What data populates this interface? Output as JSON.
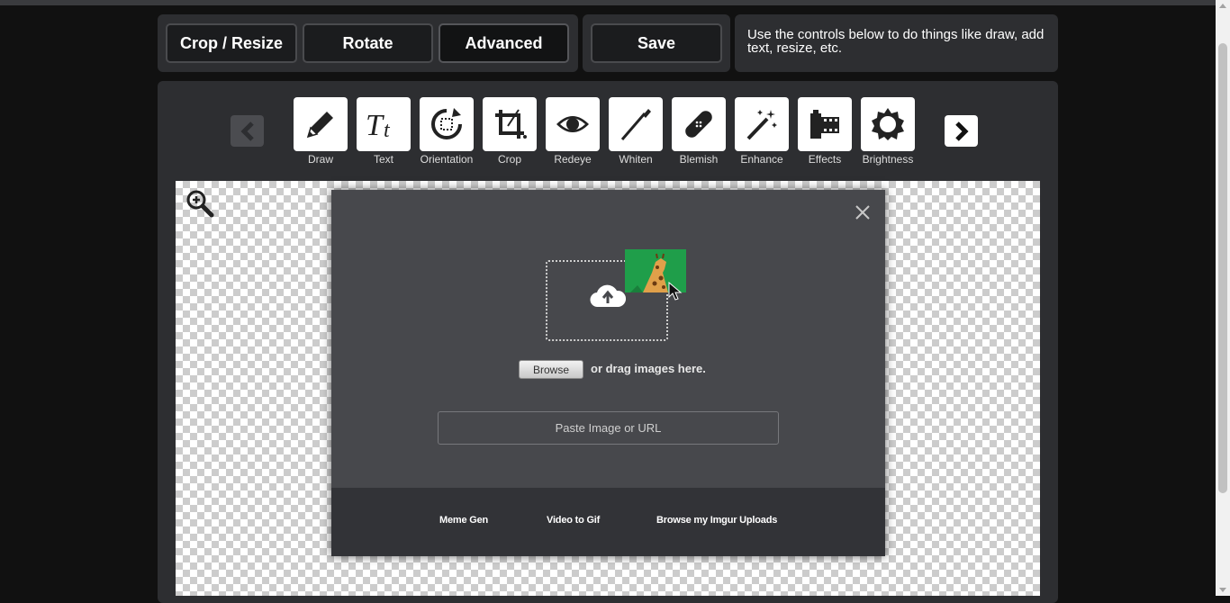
{
  "toolbar": {
    "crop_resize": "Crop / Resize",
    "rotate": "Rotate",
    "advanced": "Advanced",
    "save": "Save",
    "hint": "Use the controls below to do things like draw, add text, resize, etc."
  },
  "tools": [
    {
      "label": "Draw",
      "icon": "pencil-icon"
    },
    {
      "label": "Text",
      "icon": "text-tt-icon"
    },
    {
      "label": "Orientation",
      "icon": "orientation-icon"
    },
    {
      "label": "Crop",
      "icon": "crop-icon"
    },
    {
      "label": "Redeye",
      "icon": "eye-icon"
    },
    {
      "label": "Whiten",
      "icon": "toothbrush-icon"
    },
    {
      "label": "Blemish",
      "icon": "bandage-icon"
    },
    {
      "label": "Enhance",
      "icon": "magic-wand-icon"
    },
    {
      "label": "Effects",
      "icon": "film-icon"
    },
    {
      "label": "Brightness",
      "icon": "sun-icon"
    }
  ],
  "upload": {
    "browse": "Browse",
    "drag_text": "or drag images here.",
    "paste_placeholder": "Paste Image or URL"
  },
  "footer_links": {
    "meme": "Meme Gen",
    "video": "Video to Gif",
    "uploads": "Browse my Imgur Uploads"
  },
  "colors": {
    "panel": "#2d2e31",
    "modal": "#47484c",
    "accent_green": "#1f9e4a"
  }
}
